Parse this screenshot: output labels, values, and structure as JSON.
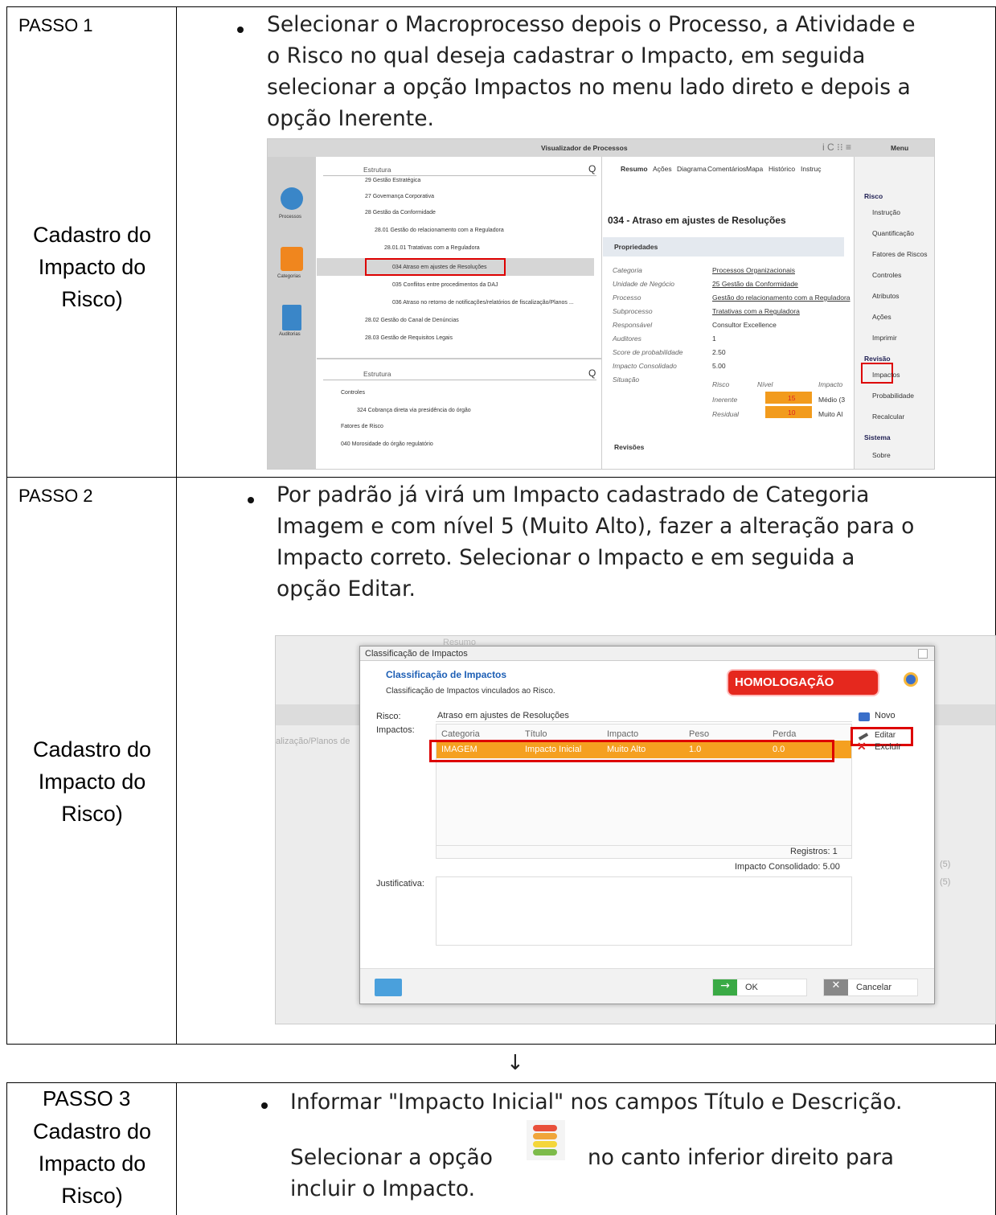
{
  "left_label": "Cadastro do Impacto do Risco)",
  "step1": {
    "label": "PASSO 1",
    "text": [
      "Selecionar o Macroprocesso depois o Processo, a Atividade e",
      "o Risco no qual deseja cadastrar o Impacto, em seguida",
      "selecionar a opção Impactos no menu lado direto e depois a",
      "opção Inerente."
    ]
  },
  "viz": {
    "title": "Visualizador de Processos",
    "menu": "Menu",
    "filter": "Estrutura",
    "tabs": [
      "Resumo",
      "Ações",
      "Diagrama",
      "Comentários",
      "Mapa",
      "Histórico",
      "Instruç"
    ],
    "tree": [
      "29 Gestão Estratégica",
      "27 Governança Corporativa",
      "28 Gestão da Conformidade",
      "28.01 Gestão do relacionamento com a Reguladora",
      "28.01.01 Tratativas com a Reguladora",
      "034 Atraso em ajustes de Resoluções",
      "035 Conflitos entre procedimentos da DAJ",
      "036 Atraso no retorno de notificações/relatórios de fiscalização/Planos ...",
      "28.02 Gestão do Canal de Denúncias",
      "28.03 Gestão de Requisitos Legais"
    ],
    "left_nav": [
      "Processos",
      "Categorias",
      "Auditorias"
    ],
    "tree2": [
      "Controles",
      "324 Cobrança direta via presidência do órgão",
      "Fatores de Risco",
      "040 Morosidade do órgão regulatório"
    ],
    "risk_title": "034 - Atraso em ajustes de Resoluções",
    "props": "Propriedades",
    "prop_rows": [
      [
        "Categoria",
        "Processos Organizacionais"
      ],
      [
        "Unidade de Negócio",
        "25 Gestão da Conformidade"
      ],
      [
        "Processo",
        "Gestão do relacionamento com a Reguladora"
      ],
      [
        "Subprocesso",
        "Tratativas com a Reguladora"
      ],
      [
        "Responsável",
        "Consultor Excellence"
      ],
      [
        "Auditores",
        "1"
      ],
      [
        "Score de probabilidade",
        "2.50"
      ],
      [
        "Impacto Consolidado",
        "5.00"
      ],
      [
        "Situação",
        ""
      ]
    ],
    "sit_head": [
      "Risco",
      "Nível",
      "Impacto"
    ],
    "sit_rows": [
      [
        "Inerente",
        "15",
        "Médio (3"
      ],
      [
        "Residual",
        "10",
        "Muito Al"
      ]
    ],
    "revisoes": "Revisões",
    "menu_items": [
      "Risco",
      "Instrução",
      "Quantificação",
      "Fatores de Riscos",
      "Controles",
      "Atributos",
      "Ações",
      "Imprimir",
      "Revisão",
      "Impactos",
      "Probabilidade",
      "Recalcular",
      "Sistema",
      "Sobre"
    ]
  },
  "step2": {
    "label": "PASSO 2",
    "text": [
      "Por padrão já virá um Impacto cadastrado de Categoria",
      "Imagem e com nível 5 (Muito Alto), fazer a alteração para o",
      "Impacto correto. Selecionar o Impacto e em seguida a",
      "opção Editar."
    ]
  },
  "dlg": {
    "title": "Classificação de Impactos",
    "heading": "Classificação de Impactos",
    "sub": "Classificação de Impactos vinculados ao Risco.",
    "badge": "HOMOLOGAÇÃO",
    "risco_label": "Risco:",
    "risco_value": "Atraso em ajustes de Resoluções",
    "impactos_label": "Impactos:",
    "cols": [
      "Categoria",
      "Título",
      "Impacto",
      "Peso",
      "Perda"
    ],
    "row": [
      "IMAGEM",
      "Impacto Inicial",
      "Muito Alto",
      "1.0",
      "0.0"
    ],
    "novo": "Novo",
    "editar": "Editar",
    "excluir": "Excluir",
    "registros": "Registros: 1",
    "consolidado": "Impacto Consolidado: 5.00",
    "justificativa": "Justificativa:",
    "ok": "OK",
    "cancelar": "Cancelar",
    "bg_tab": "Resumo",
    "bg_text": "alização/Planos de",
    "bg_r1": "(5)",
    "bg_r2": "(5)"
  },
  "arrow": "↓",
  "step3": {
    "label": "PASSO 3",
    "line1": "Informar \"Impacto Inicial\" nos campos Título e Descrição.",
    "line2a": "Selecionar a opção",
    "line2b": "no canto inferior direito para",
    "line3": "incluir o Impacto."
  }
}
